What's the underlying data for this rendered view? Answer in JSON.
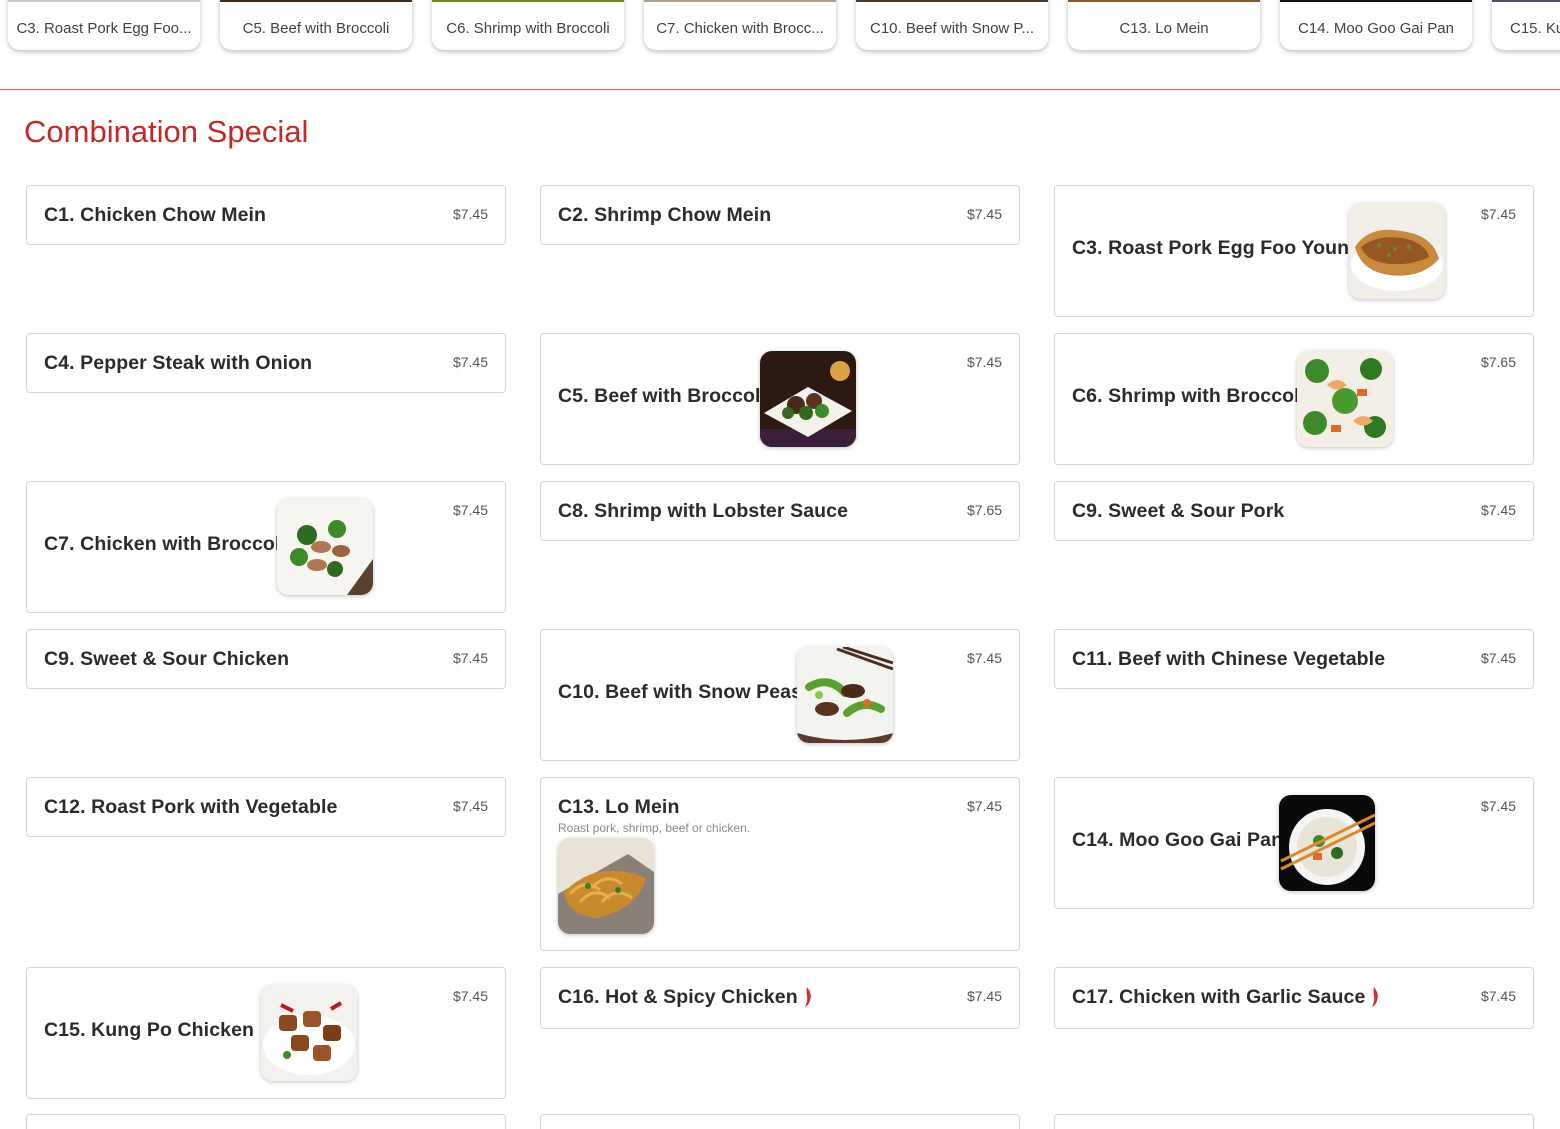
{
  "tabs": [
    {
      "label": "C3. Roast Pork Egg Foo..."
    },
    {
      "label": "C5. Beef with Broccoli"
    },
    {
      "label": "C6. Shrimp with Broccoli"
    },
    {
      "label": "C7. Chicken with Brocc..."
    },
    {
      "label": "C10. Beef with Snow P..."
    },
    {
      "label": "C13. Lo Mein"
    },
    {
      "label": "C14. Moo Goo Gai Pan"
    },
    {
      "label": "C15. Ku"
    }
  ],
  "section": {
    "title": "Combination Special"
  },
  "items": [
    {
      "name": "C1. Chicken Chow Mein",
      "price": "$7.45"
    },
    {
      "name": "C2. Shrimp Chow Mein",
      "price": "$7.45"
    },
    {
      "name": "C3. Roast Pork Egg Foo Young",
      "price": "$7.45"
    },
    {
      "name": "C4. Pepper Steak with Onion",
      "price": "$7.45"
    },
    {
      "name": "C5. Beef with Broccoli",
      "price": "$7.45"
    },
    {
      "name": "C6. Shrimp with Broccoli",
      "price": "$7.65"
    },
    {
      "name": "C7. Chicken with Broccoli",
      "price": "$7.45"
    },
    {
      "name": "C8. Shrimp with Lobster Sauce",
      "price": "$7.65"
    },
    {
      "name": "C9. Sweet & Sour Pork",
      "price": "$7.45"
    },
    {
      "name": "C9. Sweet & Sour Chicken",
      "price": "$7.45"
    },
    {
      "name": "C10. Beef with Snow Peas",
      "price": "$7.45"
    },
    {
      "name": "C11. Beef with Chinese Vegetable",
      "price": "$7.45"
    },
    {
      "name": "C12. Roast Pork with Vegetable",
      "price": "$7.45"
    },
    {
      "name": "C13. Lo Mein",
      "price": "$7.45",
      "description": "Roast pork, shrimp, beef or chicken."
    },
    {
      "name": "C14. Moo Goo Gai Pan",
      "price": "$7.45"
    },
    {
      "name": "C15. Kung Po Chicken",
      "price": "$7.45",
      "spicy": true
    },
    {
      "name": "C16. Hot & Spicy Chicken",
      "price": "$7.45",
      "spicy": true
    },
    {
      "name": "C17. Chicken with Garlic Sauce",
      "price": "$7.45",
      "spicy": true
    }
  ],
  "icons": {
    "spicy": "chili-pepper-icon"
  },
  "colors": {
    "accent": "#c62828",
    "divider": "#d9534f",
    "chili": "#d32f2f"
  }
}
